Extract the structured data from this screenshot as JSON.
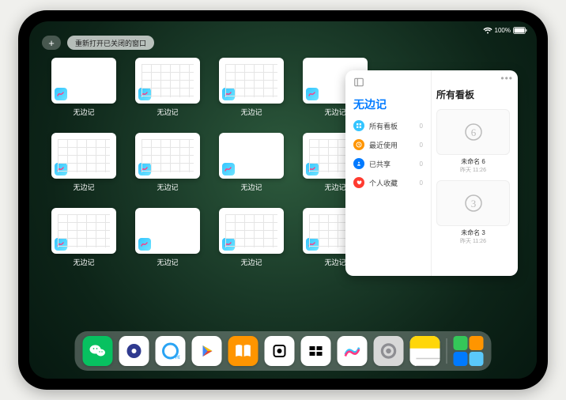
{
  "status_bar": {
    "battery_pct": "100%"
  },
  "top": {
    "restore_label": "重新打开已关闭的窗口"
  },
  "windows": [
    {
      "label": "无边记",
      "style": "blank"
    },
    {
      "label": "无边记",
      "style": "cal"
    },
    {
      "label": "无边记",
      "style": "cal"
    },
    {
      "label": "无边记",
      "style": "blank"
    },
    {
      "label": "无边记",
      "style": "cal"
    },
    {
      "label": "无边记",
      "style": "cal"
    },
    {
      "label": "无边记",
      "style": "blank"
    },
    {
      "label": "无边记",
      "style": "cal"
    },
    {
      "label": "无边记",
      "style": "cal"
    },
    {
      "label": "无边记",
      "style": "blank"
    },
    {
      "label": "无边记",
      "style": "cal"
    },
    {
      "label": "无边记",
      "style": "cal"
    }
  ],
  "panel": {
    "left_title": "无边记",
    "right_title": "所有看板",
    "menu": [
      {
        "label": "所有看板",
        "count": "0",
        "color": "#34c5ff"
      },
      {
        "label": "最近使用",
        "count": "0",
        "color": "#ff9500"
      },
      {
        "label": "已共享",
        "count": "0",
        "color": "#007aff"
      },
      {
        "label": "个人收藏",
        "count": "0",
        "color": "#ff3b30"
      }
    ],
    "boards": [
      {
        "num": "6",
        "label": "未命名 6",
        "time": "昨天 11:26"
      },
      {
        "num": "3",
        "label": "未命名 3",
        "time": "昨天 11:26"
      }
    ]
  },
  "dock": {
    "items": [
      {
        "name": "wechat",
        "bg": "#07c160"
      },
      {
        "name": "quark",
        "bg": "#fff"
      },
      {
        "name": "qq-browser",
        "bg": "#fff"
      },
      {
        "name": "play",
        "bg": "#fff"
      },
      {
        "name": "books",
        "bg": "#ff9500"
      },
      {
        "name": "inshot",
        "bg": "#fff"
      },
      {
        "name": "capcut",
        "bg": "#fff"
      },
      {
        "name": "freeform",
        "bg": "#fff"
      },
      {
        "name": "settings",
        "bg": "#d8d8d8"
      },
      {
        "name": "notes",
        "bg": "#fff"
      },
      {
        "name": "recent-apps",
        "bg": ""
      }
    ]
  }
}
